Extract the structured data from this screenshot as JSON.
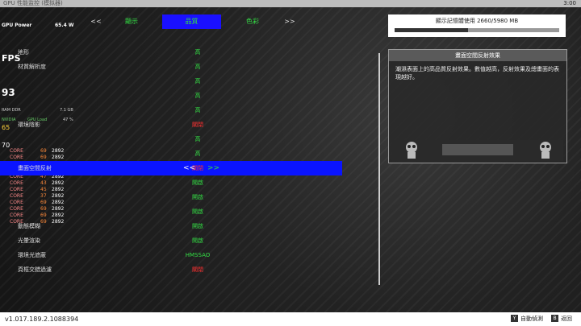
{
  "app_title": "GPU 性能监控 (模拟器)",
  "clock": "3:00",
  "overlay": {
    "gpu_power_label": "GPU Power",
    "gpu_power_value": "65.4 W",
    "fps_label": "FPS",
    "fps_value": "93",
    "gpu_temp": "65",
    "cpu_temp": "70",
    "nvidia_label": "NVIDIA",
    "gpu_load_label": "GPU Load",
    "gpu_load_value": "47 %",
    "ram_label": "RAM DDR",
    "ram_value": "7.1 GB",
    "cores": [
      {
        "label": "CORE",
        "load": "69",
        "clock": "2892"
      },
      {
        "label": "CORE",
        "load": "69",
        "clock": "2892"
      },
      {
        "label": "CORE",
        "load": "69",
        "clock": "2892"
      },
      {
        "label": "CORE",
        "load": "46",
        "clock": "2892"
      },
      {
        "label": "CORE",
        "load": "47",
        "clock": "2892"
      },
      {
        "label": "CORE",
        "load": "43",
        "clock": "2892"
      },
      {
        "label": "CORE",
        "load": "45",
        "clock": "2892"
      },
      {
        "label": "CORE",
        "load": "37",
        "clock": "2892"
      },
      {
        "label": "CORE",
        "load": "69",
        "clock": "2892"
      },
      {
        "label": "CORE",
        "load": "69",
        "clock": "2892"
      },
      {
        "label": "CORE",
        "load": "69",
        "clock": "2892"
      },
      {
        "label": "CORE",
        "load": "69",
        "clock": "2892"
      }
    ]
  },
  "tabs": {
    "prev_arrow": "<<",
    "next_arrow": ">>",
    "items": [
      {
        "label": "顯示"
      },
      {
        "label": "品質"
      },
      {
        "label": "色彩"
      }
    ]
  },
  "settings": [
    {
      "label": "地形",
      "value": "高"
    },
    {
      "label": "材質解析度",
      "value": "高"
    },
    {
      "label": "",
      "value": "高"
    },
    {
      "label": "",
      "value": "高"
    },
    {
      "label": "",
      "value": "高"
    },
    {
      "label": "環境陰影",
      "value": "關閉"
    },
    {
      "label": "",
      "value": "高"
    },
    {
      "label": "",
      "value": "高"
    },
    {
      "label": "畫面空間反射",
      "value": "關閉"
    },
    {
      "label": "",
      "value": "開啟"
    },
    {
      "label": "",
      "value": "開啟"
    },
    {
      "label": "",
      "value": "開啟"
    },
    {
      "label": "動態模糊",
      "value": "開啟"
    },
    {
      "label": "光暈渲染",
      "value": "開啟"
    },
    {
      "label": "環境光遮蔽",
      "value": "HMSSAO"
    },
    {
      "label": "頁框交錯過濾",
      "value": "關閉"
    }
  ],
  "memory": {
    "title": "顯示記憶體使用",
    "usage": "2660/5980 MB",
    "fraction": 0.445
  },
  "description": {
    "title": "畫面空間反射效果",
    "text": "潮濕表面上的高品質反射效果。數值越高，反射效果及總畫面的表現越好。"
  },
  "footer": {
    "version": "v1.017.189.2.1088394",
    "auto_detect_key": "Y",
    "auto_detect_label": "自動偵測",
    "back_key": "B",
    "back_label": "返回"
  },
  "colors": {
    "selected_row": "#0a14ff",
    "value_green": "#33dd44",
    "value_red": "#ff3030",
    "tab_active": "#1a10ff"
  }
}
